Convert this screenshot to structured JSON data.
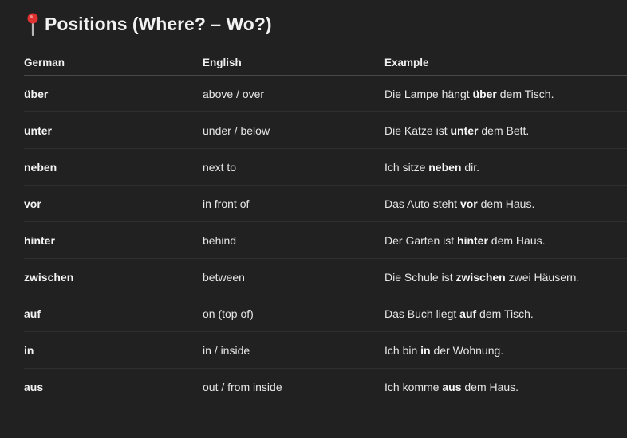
{
  "title": "Positions (Where? – Wo?)",
  "title_icon": "round-pushpin-icon",
  "accent_color": "#e03131",
  "headers": {
    "german": "German",
    "english": "English",
    "example": "Example"
  },
  "rows": [
    {
      "german": "über",
      "english": "above / over",
      "example_before": "Die Lampe hängt ",
      "example_bold": "über",
      "example_after": " dem Tisch."
    },
    {
      "german": "unter",
      "english": "under / below",
      "example_before": "Die Katze ist ",
      "example_bold": "unter",
      "example_after": " dem Bett."
    },
    {
      "german": "neben",
      "english": "next to",
      "example_before": "Ich sitze ",
      "example_bold": "neben",
      "example_after": " dir."
    },
    {
      "german": "vor",
      "english": "in front of",
      "example_before": "Das Auto steht ",
      "example_bold": "vor",
      "example_after": " dem Haus."
    },
    {
      "german": "hinter",
      "english": "behind",
      "example_before": "Der Garten ist ",
      "example_bold": "hinter",
      "example_after": " dem Haus."
    },
    {
      "german": "zwischen",
      "english": "between",
      "example_before": "Die Schule ist ",
      "example_bold": "zwischen",
      "example_after": " zwei Häusern."
    },
    {
      "german": "auf",
      "english": "on (top of)",
      "example_before": "Das Buch liegt ",
      "example_bold": "auf",
      "example_after": " dem Tisch."
    },
    {
      "german": "in",
      "english": "in / inside",
      "example_before": "Ich bin ",
      "example_bold": "in",
      "example_after": " der Wohnung."
    },
    {
      "german": "aus",
      "english": "out / from inside",
      "example_before": "Ich komme ",
      "example_bold": "aus",
      "example_after": " dem Haus."
    }
  ]
}
